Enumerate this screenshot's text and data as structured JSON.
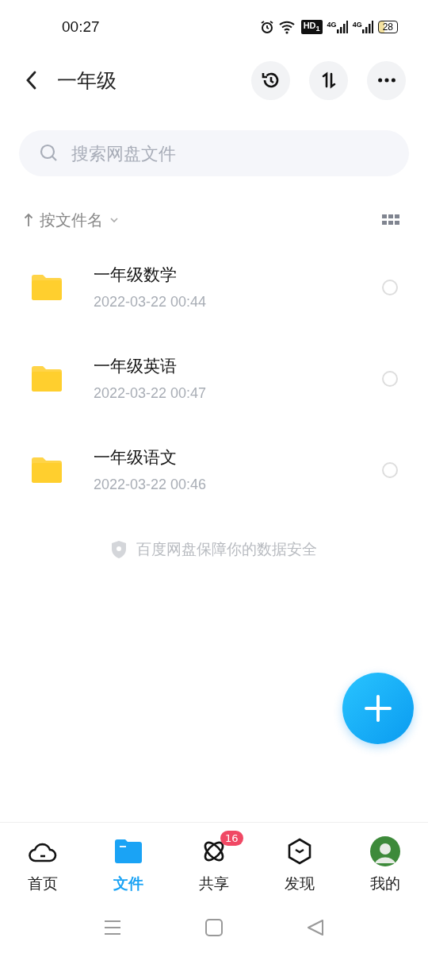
{
  "status_bar": {
    "time": "00:27",
    "hd": "HD$_{1}$",
    "networks": [
      "4G",
      "4G"
    ],
    "battery": "28"
  },
  "header": {
    "title": "一年级"
  },
  "search": {
    "placeholder": "搜索网盘文件"
  },
  "sort": {
    "label": "按文件名"
  },
  "files": [
    {
      "name": "一年级数学",
      "date": "2022-03-22  00:44",
      "selected": false
    },
    {
      "name": "一年级英语",
      "date": "2022-03-22  00:47",
      "selected": false
    },
    {
      "name": "一年级语文",
      "date": "2022-03-22  00:46",
      "selected": false
    }
  ],
  "footer_note": "百度网盘保障你的数据安全",
  "nav": [
    {
      "kind": "home",
      "label": "首页",
      "selected": false
    },
    {
      "kind": "files",
      "label": "文件",
      "selected": true
    },
    {
      "kind": "share",
      "label": "共享",
      "selected": false,
      "badge": "16"
    },
    {
      "kind": "discover",
      "label": "发现",
      "selected": false
    },
    {
      "kind": "me",
      "label": "我的",
      "selected": false
    }
  ]
}
